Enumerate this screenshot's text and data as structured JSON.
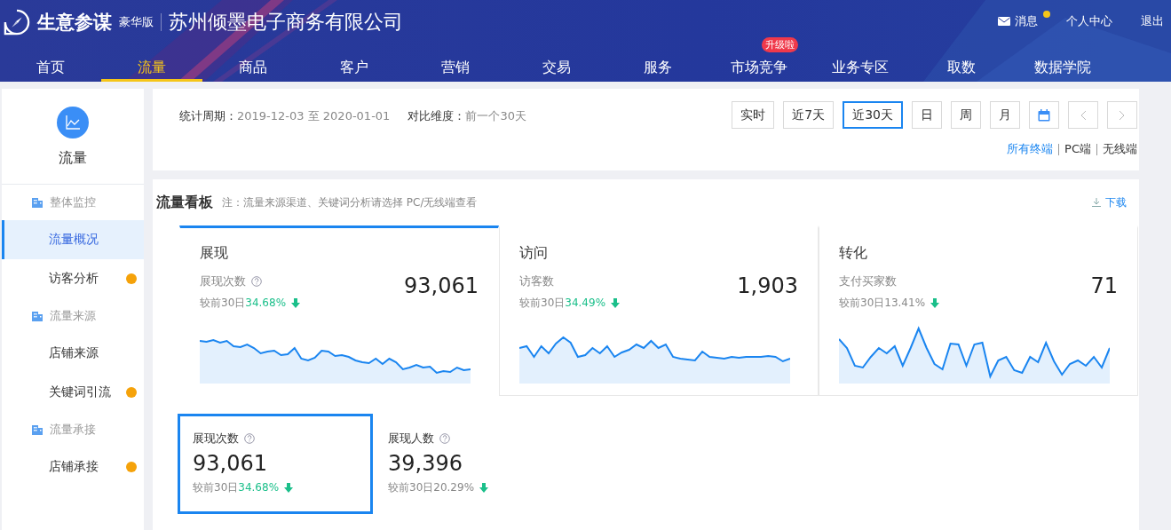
{
  "header": {
    "brand": "生意参谋",
    "edition": "豪华版",
    "company": "苏州倾墨电子商务有限公司",
    "links": [
      {
        "label": "消息",
        "kind": "message",
        "unread": true
      },
      {
        "label": "个人中心",
        "kind": "plain",
        "unread": false
      },
      {
        "label": "退出",
        "kind": "plain",
        "unread": false
      }
    ]
  },
  "nav": [
    {
      "label": "首页",
      "selected": false
    },
    {
      "label": "流量",
      "selected": true
    },
    {
      "label": "商品",
      "selected": false
    },
    {
      "label": "客户",
      "selected": false
    },
    {
      "label": "营销",
      "selected": false
    },
    {
      "label": "交易",
      "selected": false
    },
    {
      "label": "服务",
      "selected": false
    },
    {
      "label": "市场竞争",
      "selected": false,
      "badge": "升级啦"
    },
    {
      "label": "业务专区",
      "selected": false
    },
    {
      "label": "取数",
      "selected": false
    },
    {
      "label": "数据学院",
      "selected": false
    }
  ],
  "sidebar": {
    "title": "流量",
    "groups": [
      {
        "label": "整体监控",
        "children": [
          {
            "label": "流量概况",
            "selected": true,
            "dot": false
          },
          {
            "label": "访客分析",
            "selected": false,
            "dot": true
          }
        ]
      },
      {
        "label": "流量来源",
        "children": [
          {
            "label": "店铺来源",
            "selected": false,
            "dot": false
          },
          {
            "label": "关键词引流",
            "selected": false,
            "dot": true
          }
        ]
      },
      {
        "label": "流量承接",
        "children": [
          {
            "label": "店铺承接",
            "selected": false,
            "dot": true
          }
        ]
      }
    ]
  },
  "filter": {
    "period_label": "统计周期：",
    "period": "2019-12-03 至 2020-01-01",
    "compare_label": "对比维度：",
    "compare": "前一个30天",
    "ranges": [
      {
        "label": "实时",
        "kind": "text",
        "selected": false
      },
      {
        "label": "近7天",
        "kind": "text",
        "selected": false
      },
      {
        "label": "近30天",
        "kind": "text",
        "selected": true
      },
      {
        "label": "日",
        "kind": "text",
        "selected": false
      },
      {
        "label": "周",
        "kind": "text",
        "selected": false
      },
      {
        "label": "月",
        "kind": "text",
        "selected": false
      },
      {
        "kind": "calendar",
        "selected": false
      },
      {
        "kind": "prev",
        "selected": false
      },
      {
        "kind": "next",
        "selected": false
      }
    ],
    "terminals": [
      {
        "label": "所有终端",
        "selected": true
      },
      {
        "label": "PC端",
        "selected": false
      },
      {
        "label": "无线端",
        "selected": false
      }
    ]
  },
  "board": {
    "title": "流量看板",
    "note": "注：流量来源渠道、关键词分析请选择 PC/无线端查看",
    "download": "下载",
    "cards": [
      {
        "title": "展现",
        "metric": "展现次数",
        "help": true,
        "value": "93,061",
        "change_label": "较前30日",
        "change": "34.68%",
        "highlighted": true,
        "selected": true
      },
      {
        "title": "访问",
        "metric": "访客数",
        "help": false,
        "value": "1,903",
        "change_label": "较前30日",
        "change": "34.49%",
        "highlighted": true,
        "selected": false
      },
      {
        "title": "转化",
        "metric": "支付买家数",
        "help": false,
        "value": "71",
        "change_label": "较前30日",
        "change": "13.41%",
        "highlighted": false,
        "selected": false
      }
    ],
    "details": [
      {
        "metric": "展现次数",
        "value": "93,061",
        "change_label": "较前30日",
        "change": "34.68%",
        "highlighted": true,
        "selected": true
      },
      {
        "metric": "展现人数",
        "value": "39,396",
        "change_label": "较前30日",
        "change": "20.29%",
        "highlighted": false,
        "selected": false
      }
    ]
  }
}
